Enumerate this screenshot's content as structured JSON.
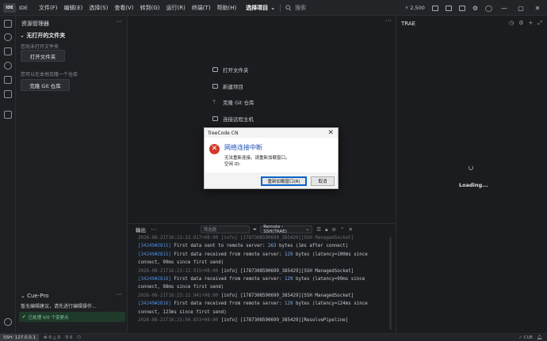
{
  "titlebar": {
    "logo": "IDE",
    "ide_label": "IDE",
    "menus": [
      "文件(F)",
      "编辑(E)",
      "选择(S)",
      "查看(V)",
      "转到(G)",
      "运行(R)",
      "终端(T)",
      "帮助(H)"
    ],
    "select_project": "选择项目",
    "search_placeholder": "搜索",
    "count": "2,500",
    "window_controls": [
      "—",
      "▢",
      "✕"
    ]
  },
  "sidebar": {
    "header": "资源管理器",
    "section": "无打开的文件夹",
    "hint_open": "您尚未打开文件夹",
    "open_folder_button": "打开文件夹",
    "hint_clone": "您可以在本地克隆一个仓库",
    "clone_button": "克隆 Git 仓库",
    "cue": {
      "title": "Cue-Pro",
      "message": "暂无编辑建议，请先进行编辑操作...",
      "status": "已处理 0/0 个变更点"
    }
  },
  "welcome": {
    "items": [
      {
        "label": "打开文件夹",
        "icon": "folder-icon"
      },
      {
        "label": "新建项目",
        "icon": "new-project-icon"
      },
      {
        "label": "克隆 Git 仓库",
        "icon": "git-branch-icon"
      },
      {
        "label": "连接远程主机",
        "icon": "remote-host-icon"
      }
    ]
  },
  "ai_panel": {
    "title": "TRAE",
    "loading": "Loading..."
  },
  "output": {
    "tab": "输出",
    "filter_placeholder": "筛选器",
    "channel": "Remote - SSH(TRAE)"
  },
  "log_lines": [
    [
      {
        "t": "ts",
        "v": "2026-08-21T16:23:22.917+08:00 [info] [1787308590699_385429][SSH ManagedSocket]"
      }
    ],
    [
      {
        "t": "tag",
        "v": "[34249#2815]"
      },
      {
        "t": "txt",
        "v": " First data sent to remote server: "
      },
      {
        "t": "num",
        "v": "263"
      },
      {
        "t": "txt",
        "v": " bytes (1ms after connect)"
      }
    ],
    [
      {
        "t": "tag",
        "v": "[34249#2815]"
      },
      {
        "t": "txt",
        "v": " First data received from remote server: "
      },
      {
        "t": "num",
        "v": "129"
      },
      {
        "t": "txt",
        "v": " bytes (latency=100ms since"
      }
    ],
    [
      {
        "t": "txt",
        "v": "connect, 99ms since first send)"
      }
    ],
    [
      {
        "t": "ts",
        "v": "2026-08-21T16:23:22.915+08:00"
      },
      {
        "t": "txt",
        "v": " [info] [1787308590699_385429][SSH ManagedSocket]"
      }
    ],
    [
      {
        "t": "tag",
        "v": "[34249#2816]"
      },
      {
        "t": "txt",
        "v": " First data received from remote server: "
      },
      {
        "t": "num",
        "v": "129"
      },
      {
        "t": "txt",
        "v": " bytes (latency=99ms since"
      }
    ],
    [
      {
        "t": "txt",
        "v": "connect, 98ms since first send)"
      }
    ],
    [
      {
        "t": "ts",
        "v": "2026-08-21T16:23:22.941+08:00"
      },
      {
        "t": "txt",
        "v": " [info] [1787308590699_385429][SSH ManagedSocket]"
      }
    ],
    [
      {
        "t": "tag",
        "v": "[34249#2816]"
      },
      {
        "t": "txt",
        "v": " First data received from remote server: "
      },
      {
        "t": "num",
        "v": "129"
      },
      {
        "t": "txt",
        "v": " bytes (latency=124ms since"
      }
    ],
    [
      {
        "t": "txt",
        "v": "connect, 123ms since first send)"
      }
    ],
    [
      {
        "t": "ts",
        "v": "2026-08-21T16:23:50.833+08:00"
      },
      {
        "t": "txt",
        "v": " [info] [1787308590699_385429][ResolvePipeline]"
      }
    ]
  ],
  "statusbar": {
    "remote": "SSH: 127.0.0.1",
    "problems": "0 △ 0",
    "ports": "0",
    "right": [
      "CUE"
    ]
  },
  "dialog": {
    "title": "TreeCode CN",
    "heading": "网络连接中断",
    "message_line1": "无法重新连接。请重新加载窗口。",
    "message_line2": "空闲 ID:",
    "reload_button": "重新加载窗口(R)",
    "cancel_button": "取消",
    "close_glyph": "✕"
  },
  "colors": {
    "background": "#1b1c1f",
    "accent_blue": "#4e8fe0",
    "error_red": "#d23a2a",
    "dialog_heading": "#1d4fb3"
  }
}
